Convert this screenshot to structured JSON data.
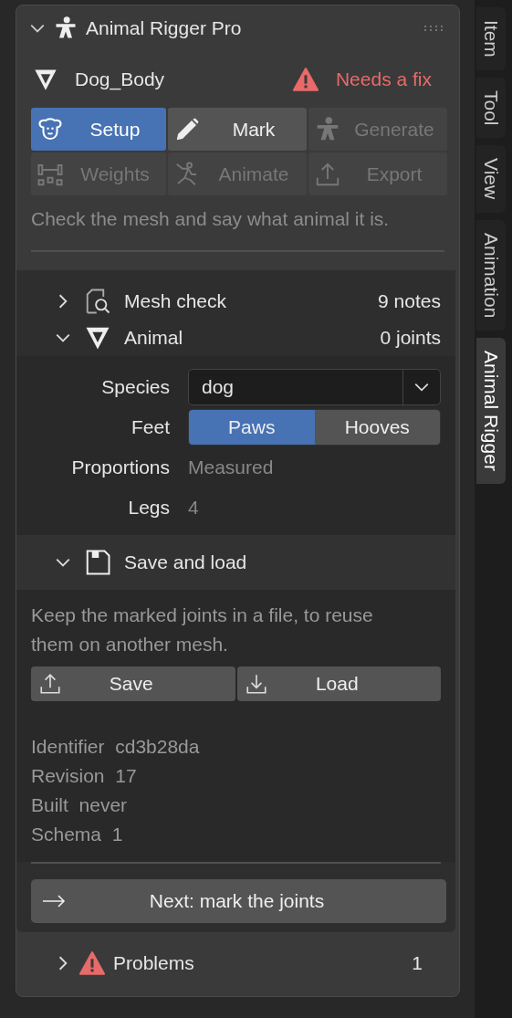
{
  "panel": {
    "title": "Animal Rigger Pro",
    "expanded": true
  },
  "object": {
    "name": "Dog_Body",
    "status": "Needs a fix"
  },
  "steps": [
    {
      "label": "Setup",
      "selected": true,
      "disabled": false
    },
    {
      "label": "Mark",
      "selected": false,
      "disabled": false
    },
    {
      "label": "Generate",
      "selected": false,
      "disabled": true
    },
    {
      "label": "Weights",
      "selected": false,
      "disabled": true
    },
    {
      "label": "Animate",
      "selected": false,
      "disabled": true
    },
    {
      "label": "Export",
      "selected": false,
      "disabled": true
    }
  ],
  "hint": "Check the mesh and say what animal it is.",
  "sections": [
    {
      "title": "Mesh check",
      "count": "9 notes",
      "expanded": false
    },
    {
      "title": "Animal",
      "count": "0 joints",
      "expanded": true,
      "fields": [
        {
          "kind": "dropdown",
          "label": "Species",
          "value": "dog"
        },
        {
          "kind": "toggle",
          "label": "Feet",
          "options": [
            {
              "label": "Paws",
              "selected": true
            },
            {
              "label": "Hooves",
              "selected": false
            }
          ]
        },
        {
          "kind": "readout",
          "label": "Proportions",
          "value": "Measured"
        },
        {
          "kind": "readout",
          "label": "Legs",
          "value": "4"
        }
      ]
    }
  ],
  "save_load": {
    "title": "Save and load",
    "expanded": true,
    "description": "Keep the marked joints in a file, to reuse them on another mesh.",
    "buttons": [
      "Save",
      "Load"
    ],
    "info": [
      {
        "label": "Identifier",
        "value": "cd3b28da"
      },
      {
        "label": "Revision",
        "value": "17"
      },
      {
        "label": "Built",
        "value": "never"
      },
      {
        "label": "Schema",
        "value": "1"
      }
    ]
  },
  "next_button": "Next: mark the joints",
  "problems": {
    "title": "Problems",
    "count": "1",
    "expanded": false
  },
  "tabs": [
    {
      "label": "Item",
      "selected": false
    },
    {
      "label": "Tool",
      "selected": false
    },
    {
      "label": "View",
      "selected": false
    },
    {
      "label": "Animation",
      "selected": false
    },
    {
      "label": "Animal Rigger",
      "selected": true
    }
  ]
}
